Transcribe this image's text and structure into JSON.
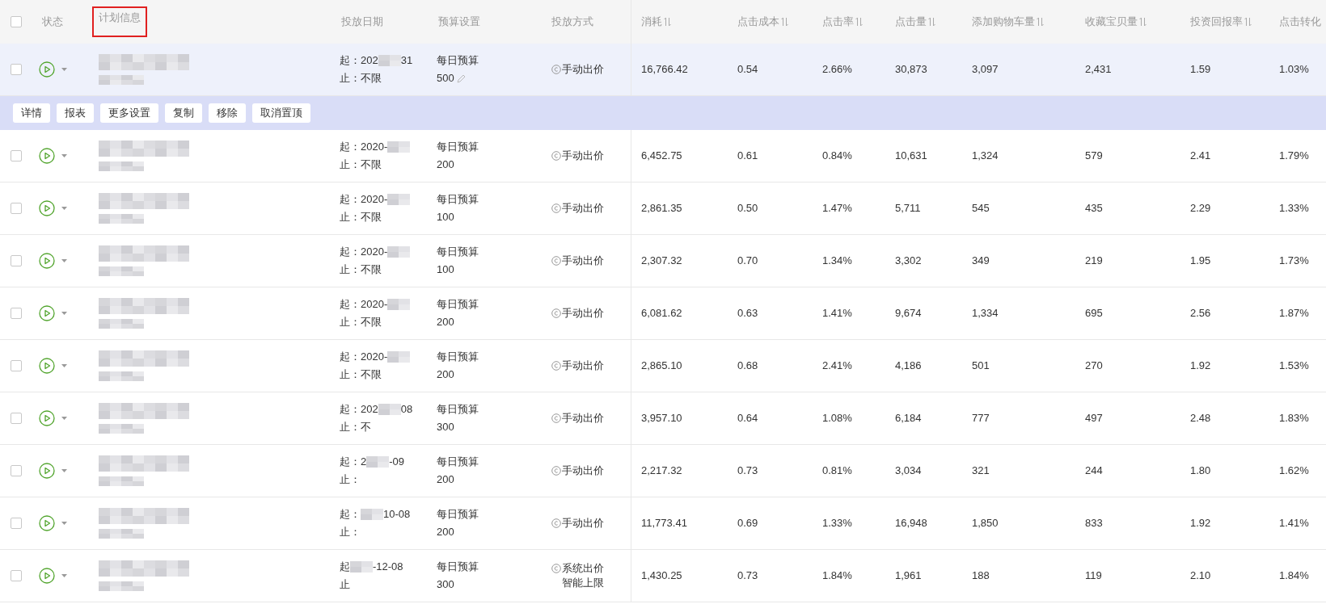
{
  "header": {
    "checked": false
  },
  "columns": [
    {
      "label": "状态",
      "highlighted": false
    },
    {
      "label": "计划信息",
      "highlighted": true
    },
    {
      "label": "投放日期",
      "highlighted": false
    },
    {
      "label": "预算设置",
      "highlighted": false
    },
    {
      "label": "投放方式",
      "highlighted": false
    },
    {
      "label": "消耗",
      "sortable": true,
      "highlighted": false
    },
    {
      "label": "点击成本",
      "sortable": true,
      "highlighted": false
    },
    {
      "label": "点击率",
      "sortable": true,
      "highlighted": false
    },
    {
      "label": "点击量",
      "sortable": true,
      "highlighted": false
    },
    {
      "label": "添加购物车量",
      "sortable": true,
      "highlighted": false
    },
    {
      "label": "收藏宝贝量",
      "sortable": true,
      "highlighted": false
    },
    {
      "label": "投资回报率",
      "sortable": true,
      "highlighted": false
    },
    {
      "label": "点击转化",
      "highlighted": false
    }
  ],
  "actions": [
    "详情",
    "报表",
    "更多设置",
    "复制",
    "移除",
    "取消置顶"
  ],
  "rows": [
    {
      "selected": true,
      "checked": false,
      "start": {
        "before": "起：202",
        "after": "31"
      },
      "end": "止：不限",
      "budget_label": "每日预算",
      "budget": "500",
      "editable": true,
      "method": "手动出价",
      "metrics": [
        "16,766.42",
        "0.54",
        "2.66%",
        "30,873",
        "3,097",
        "2,431",
        "1.59",
        "1.03%"
      ]
    },
    {
      "selected": false,
      "checked": false,
      "start": {
        "before": "起：2020-"
      },
      "end": "止：不限",
      "budget_label": "每日预算",
      "budget": "200",
      "editable": false,
      "method": "手动出价",
      "metrics": [
        "6,452.75",
        "0.61",
        "0.84%",
        "10,631",
        "1,324",
        "579",
        "2.41",
        "1.79%"
      ]
    },
    {
      "selected": false,
      "checked": false,
      "start": {
        "before": "起：2020-"
      },
      "end": "止：不限",
      "budget_label": "每日预算",
      "budget": "100",
      "editable": false,
      "method": "手动出价",
      "metrics": [
        "2,861.35",
        "0.50",
        "1.47%",
        "5,711",
        "545",
        "435",
        "2.29",
        "1.33%"
      ]
    },
    {
      "selected": false,
      "checked": false,
      "start": {
        "before": "起：2020-"
      },
      "end": "止：不限",
      "budget_label": "每日预算",
      "budget": "100",
      "editable": false,
      "method": "手动出价",
      "metrics": [
        "2,307.32",
        "0.70",
        "1.34%",
        "3,302",
        "349",
        "219",
        "1.95",
        "1.73%"
      ]
    },
    {
      "selected": false,
      "checked": false,
      "start": {
        "before": "起：2020-"
      },
      "end": "止：不限",
      "budget_label": "每日预算",
      "budget": "200",
      "editable": false,
      "method": "手动出价",
      "metrics": [
        "6,081.62",
        "0.63",
        "1.41%",
        "9,674",
        "1,334",
        "695",
        "2.56",
        "1.87%"
      ]
    },
    {
      "selected": false,
      "checked": false,
      "start": {
        "before": "起：2020-"
      },
      "end": "止：不限",
      "budget_label": "每日预算",
      "budget": "200",
      "editable": false,
      "method": "手动出价",
      "metrics": [
        "2,865.10",
        "0.68",
        "2.41%",
        "4,186",
        "501",
        "270",
        "1.92",
        "1.53%"
      ]
    },
    {
      "selected": false,
      "checked": false,
      "start": {
        "before": "起：202",
        "after": "08"
      },
      "end": "止：不",
      "budget_label": "每日预算",
      "budget": "300",
      "editable": false,
      "method": "手动出价",
      "metrics": [
        "3,957.10",
        "0.64",
        "1.08%",
        "6,184",
        "777",
        "497",
        "2.48",
        "1.83%"
      ]
    },
    {
      "selected": false,
      "checked": false,
      "start": {
        "before": "起：2",
        "after": "-09"
      },
      "end": "止：",
      "budget_label": "每日预算",
      "budget": "200",
      "editable": false,
      "method": "手动出价",
      "metrics": [
        "2,217.32",
        "0.73",
        "0.81%",
        "3,034",
        "321",
        "244",
        "1.80",
        "1.62%"
      ]
    },
    {
      "selected": false,
      "checked": false,
      "start": {
        "before": "起：",
        "after": "10-08"
      },
      "end": "止：",
      "budget_label": "每日预算",
      "budget": "200",
      "editable": false,
      "method": "手动出价",
      "metrics": [
        "11,773.41",
        "0.69",
        "1.33%",
        "16,948",
        "1,850",
        "833",
        "1.92",
        "1.41%"
      ]
    },
    {
      "selected": false,
      "checked": false,
      "start": {
        "before": "起",
        "after": "-12-08"
      },
      "end": "止",
      "budget_label": "每日预算",
      "budget": "300",
      "editable": false,
      "method": "系统出价",
      "method_note": "智能上限",
      "metrics": [
        "1,430.25",
        "0.73",
        "1.84%",
        "1,961",
        "188",
        "119",
        "2.10",
        "1.84%"
      ]
    }
  ]
}
